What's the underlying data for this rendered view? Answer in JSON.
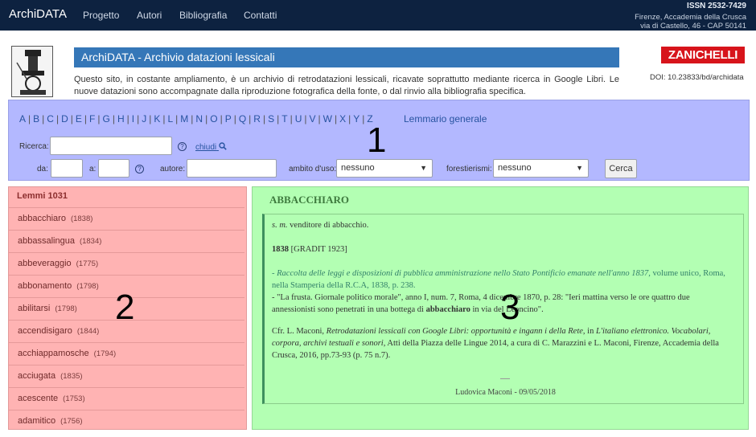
{
  "navbar": {
    "brand": "ArchiDATA",
    "links": [
      "Progetto",
      "Autori",
      "Bibliografia",
      "Contatti"
    ],
    "issn": "ISSN 2532-7429",
    "address_line1": "Firenze, Accademia della Crusca",
    "address_line2": "via di Castello, 46 - CAP 50141"
  },
  "header": {
    "title": "ArchiDATA - Archivio datazioni lessicali",
    "intro": "Questo sito, in costante ampliamento, è un archivio di retrodatazioni lessicali, ricavate soprattutto mediante ricerca in Google Libri. Le nuove datazioni sono accompagnate dalla riproduzione fotografica della fonte, o dal rinvio alla bibliografia specifica.",
    "publisher": "ZANICHELLI",
    "doi": "DOI: 10.23833/bd/archidata"
  },
  "search": {
    "letters": [
      "A",
      "B",
      "C",
      "D",
      "E",
      "F",
      "G",
      "H",
      "I",
      "J",
      "K",
      "L",
      "M",
      "N",
      "O",
      "P",
      "Q",
      "R",
      "S",
      "T",
      "U",
      "V",
      "W",
      "X",
      "Y",
      "Z"
    ],
    "lemmario_link": "Lemmario generale",
    "ricerca_label": "Ricerca:",
    "ricerca_value": "",
    "chiudi_label": "chiudi",
    "da_label": "da:",
    "a_label": "a:",
    "autore_label": "autore:",
    "ambito_label": "ambito d'uso:",
    "ambito_value": "nessuno",
    "forestierismi_label": "forestierismi:",
    "forestierismi_value": "nessuno",
    "cerca_button": "Cerca",
    "help_glyph": "?"
  },
  "panel_numbers": {
    "one": "1",
    "two": "2",
    "three": "3"
  },
  "lemmi": {
    "header": "Lemmi 1031",
    "items": [
      {
        "word": "abbacchiaro",
        "year": "(1838)"
      },
      {
        "word": "abbassalingua",
        "year": "(1834)"
      },
      {
        "word": "abbeveraggio",
        "year": "(1775)"
      },
      {
        "word": "abbonamento",
        "year": "(1798)"
      },
      {
        "word": "abilitarsi",
        "year": "(1798)"
      },
      {
        "word": "accendisigaro",
        "year": "(1844)"
      },
      {
        "word": "acchiappamosche",
        "year": "(1794)"
      },
      {
        "word": "acciugata",
        "year": "(1835)"
      },
      {
        "word": "acescente",
        "year": "(1753)"
      },
      {
        "word": "adamitico",
        "year": "(1756)"
      }
    ]
  },
  "entry": {
    "title": "ABBACCHIARO",
    "grammar": "s. m.",
    "definition": "venditore di abbacchio.",
    "date": "1838",
    "date_ref": "[GRADIT 1923]",
    "source1_italic": "- Raccolta delle leggi e disposizioni di pubblica amministrazione nello Stato Pontificio emanate nell'anno 1837",
    "source1_rest": ", volume unico, Roma, nella Stamperia della R.C.A, 1838, p. 238.",
    "source2_a": "- \"La frusta. Giornale politico morale\", anno I, num. 7, Roma, 4 dicembre 1870, p. 28: \"Ieri mattina verso le ore quattro due annessionisti sono penetrati in una bottega di ",
    "source2_bold": "abbacchiaro",
    "source2_b": " in via del Leoncino\".",
    "cfr_a": "Cfr. L. Maconi, ",
    "cfr_i1": "Retrodatazioni lessicali con Google Libri: opportunità e ingann i della Rete",
    "cfr_b": ", in ",
    "cfr_i2": "L'italiano elettronico. Vocabolari, corpora, archivi testuali e sonori",
    "cfr_c": ", Atti della Piazza delle Lingue 2014, a cura di C. Marazzini e L. Maconi, Firenze, Accademia della Crusca, 2016, pp.73-93 (p. 75 n.7).",
    "signature": "Ludovica Maconi - 09/05/2018"
  },
  "colors": {
    "navbar": "#0d2240",
    "title_bar": "#3577b8",
    "panel1": "#b3b8ff",
    "panel2": "#ffb3b3",
    "panel3": "#b3ffb3",
    "publisher": "#d7141b"
  }
}
